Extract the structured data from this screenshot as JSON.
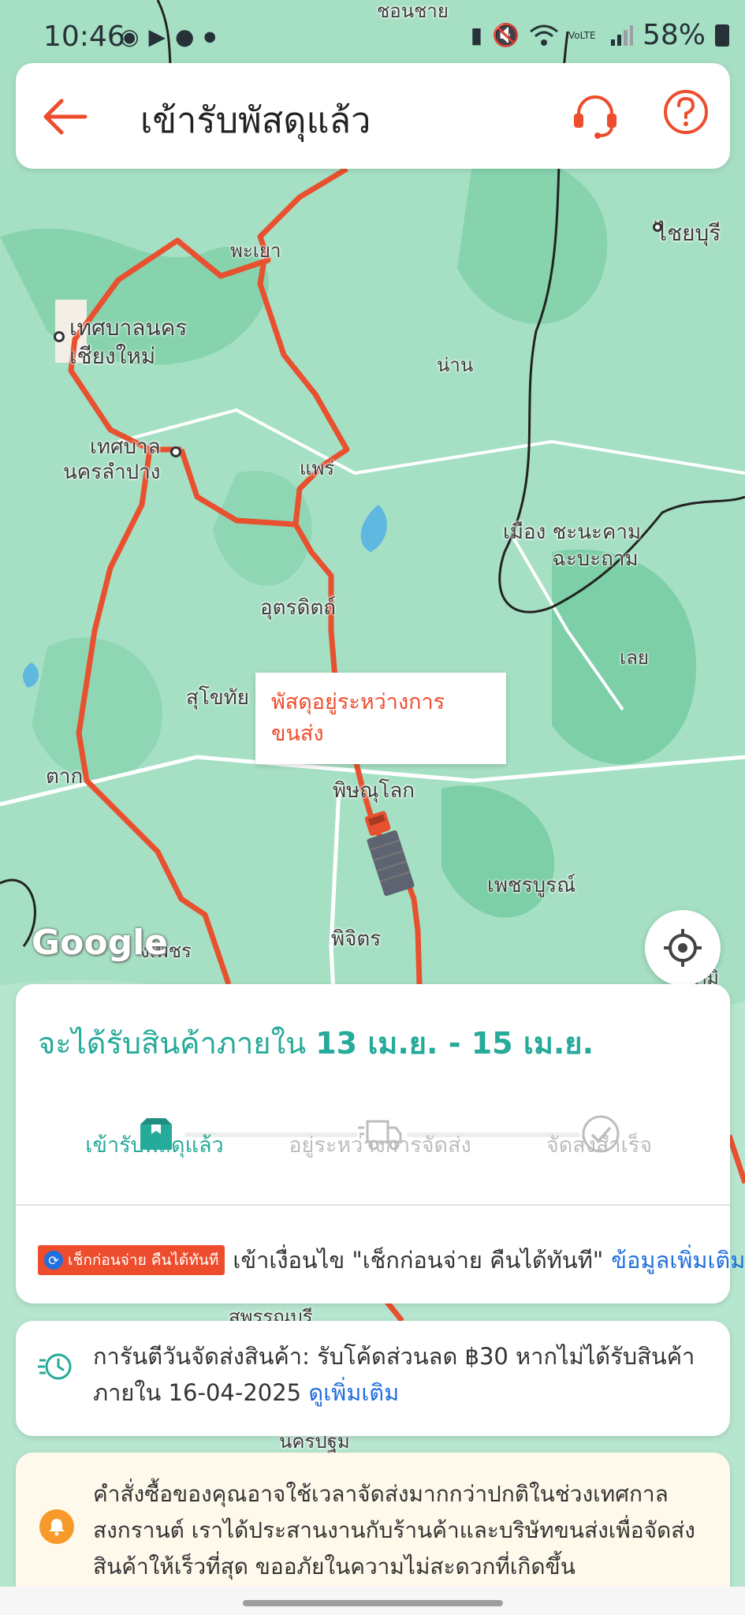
{
  "status_bar": {
    "time": "10:46",
    "notification_icons": [
      "messenger-icon",
      "youtube-icon",
      "chat-icon",
      "dot-icon"
    ],
    "right_icons": [
      "sim-icon",
      "mute-icon",
      "wifi-icon",
      "volte-icon",
      "signal-icon"
    ],
    "volte": "VoLTE",
    "battery": "58%"
  },
  "header": {
    "title": "เข้ารับพัสดุแล้ว",
    "icons": [
      "back-arrow-icon",
      "customer-support-icon",
      "help-icon"
    ],
    "accent_color": "#ee4d2d"
  },
  "map": {
    "labels": {
      "chiangrai": "ชอนชาย",
      "phayao": "พะเยา",
      "chaiyaburi": "ไชยบุรี",
      "chiangmai_1": "เทศบาลนคร",
      "chiangmai_2": "เชียงใหม่",
      "nan": "น่าน",
      "lampang_1": "เทศบาล",
      "lampang_2": "นครลำปาง",
      "phrae": "แพร่",
      "sayaboury_1": "เมือง ชะนะคาม",
      "sayaboury_2": "ฉะบะถาม",
      "uttaradit": "อุตรดิตถ์",
      "loei": "เลย",
      "sukhothai": "สุโขทัย",
      "tak": "ตาก",
      "phitsanulok": "พิษณุโลก",
      "phetchabun": "เพชรบูรณ์",
      "phichit": "พิจิตร",
      "kamphaeng": "งเพชร",
      "chaiyaphum": "ชยภูมิ",
      "suphanburi": "สพรรณบรี",
      "nakhon_pathom": "นครปฐม"
    },
    "bubble": "พัสดุอยู่ระหว่างการขนส่ง",
    "logo": "Google",
    "route_color": "#e8512f",
    "icons": [
      "truck-icon",
      "my-location-icon"
    ]
  },
  "delivery": {
    "eta_prefix": "จะได้รับสินค้าภายใน",
    "eta_dates": "13 เม.ย. - 15 เม.ย.",
    "steps": [
      {
        "label": "เข้ารับพัสดุแล้ว",
        "icon": "package-icon",
        "active": true
      },
      {
        "label": "อยู่ระหว่างการจัดส่ง",
        "icon": "delivery-truck-icon",
        "active": false
      },
      {
        "label": "จัดส่งสำเร็จ",
        "icon": "check-circle-icon",
        "active": false
      }
    ],
    "active_color": "#26aa99"
  },
  "promo": {
    "tag_text": "เช็กก่อนจ่าย คืนได้ทันที",
    "text": "เข้าเงื่อนไข \"เช็กก่อนจ่าย คืนได้ทันที\"",
    "link": "ข้อมูลเพิ่มเติม"
  },
  "guarantee": {
    "icon": "clock-fast-icon",
    "text": "การันตีวันจัดส่งสินค้า: รับโค้ดส่วนลด ฿30 หากไม่ได้รับสินค้าภายใน 16-04-2025",
    "link": "ดูเพิ่มเติม"
  },
  "notice": {
    "icon": "bell-icon",
    "text": "คำสั่งซื้อของคุณอาจใช้เวลาจัดส่งมากกว่าปกติในช่วงเทศกาลสงกรานต์ เราได้ประสานงานกับร้านค้าและบริษัทขนส่งเพื่อจัดส่งสินค้าให้เร็วที่สุด ขออภัยในความไม่สะดวกที่เกิดขึ้น"
  }
}
